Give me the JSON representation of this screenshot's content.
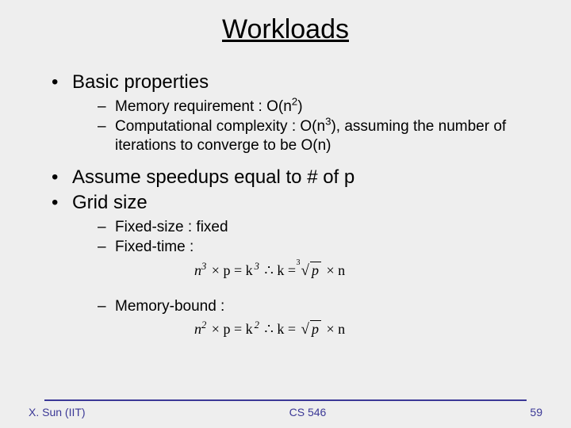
{
  "title": "Workloads",
  "bullets": {
    "b1": "Basic properties",
    "b1_1a": "Memory requirement : O(n",
    "b1_1b": ")",
    "b1_2a": "Computational complexity : O(n",
    "b1_2b": "), assuming the number of iterations to converge to be O(n)",
    "b2": "Assume speedups equal to # of p",
    "b3": "Grid size",
    "b3_1": "Fixed-size : fixed",
    "b3_2": "Fixed-time :",
    "b3_3": "Memory-bound :"
  },
  "exp": {
    "sq": "2",
    "cu": "3"
  },
  "math": {
    "ft_lhs_a": "n",
    "ft_lhs_b": " × p = k",
    "ft_therefore": " ∴ k = ",
    "ft_deg": "3",
    "ft_rad": "p",
    "ft_tail": " × n",
    "mb_lhs_a": "n",
    "mb_lhs_b": " × p = k",
    "mb_therefore": " ∴ k = ",
    "mb_rad": "p",
    "mb_tail": " × n"
  },
  "footer": {
    "left": "X. Sun (IIT)",
    "center": "CS 546",
    "right": "59"
  }
}
